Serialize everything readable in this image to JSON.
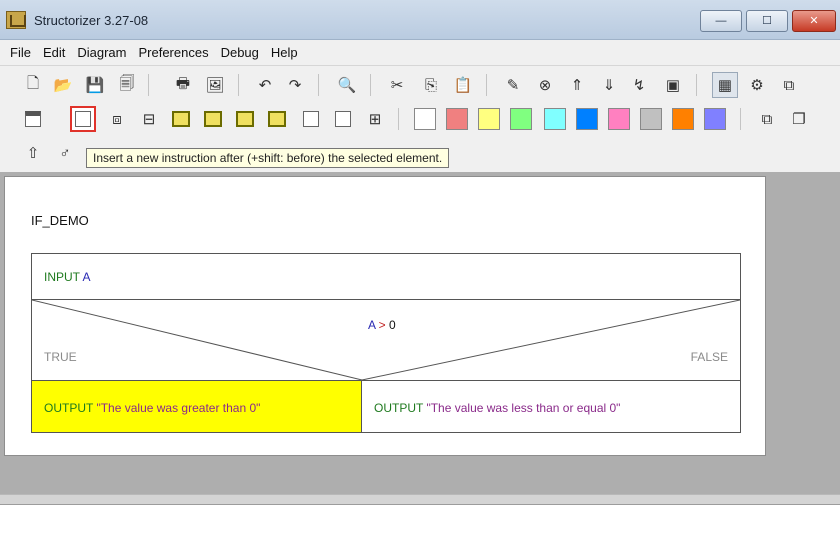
{
  "window": {
    "title": "Structorizer 3.27-08",
    "min_label": "—",
    "max_label": "☐",
    "close_label": "✕"
  },
  "menu": [
    "File",
    "Edit",
    "Diagram",
    "Preferences",
    "Debug",
    "Help"
  ],
  "tooltip": "Insert a new instruction after (+shift: before) the selected element.",
  "diagram": {
    "program_name": "IF_DEMO",
    "input_keyword": "INPUT",
    "input_var": "A",
    "condition_var": "A",
    "condition_op": " > ",
    "condition_value": "0",
    "true_label": "TRUE",
    "false_label": "FALSE",
    "true_keyword": "OUTPUT",
    "true_string": " \"The value was greater than 0\"",
    "false_keyword": "OUTPUT",
    "false_string": " \"The value was less than or equal 0\""
  },
  "colors": {
    "selected_element": "#ffff00",
    "swatches": [
      "#ffffff",
      "#f08080",
      "#ffff80",
      "#80ff80",
      "#80ffff",
      "#0080ff",
      "#ff80c0",
      "#c0c0c0",
      "#ff8000",
      "#8080ff"
    ]
  }
}
